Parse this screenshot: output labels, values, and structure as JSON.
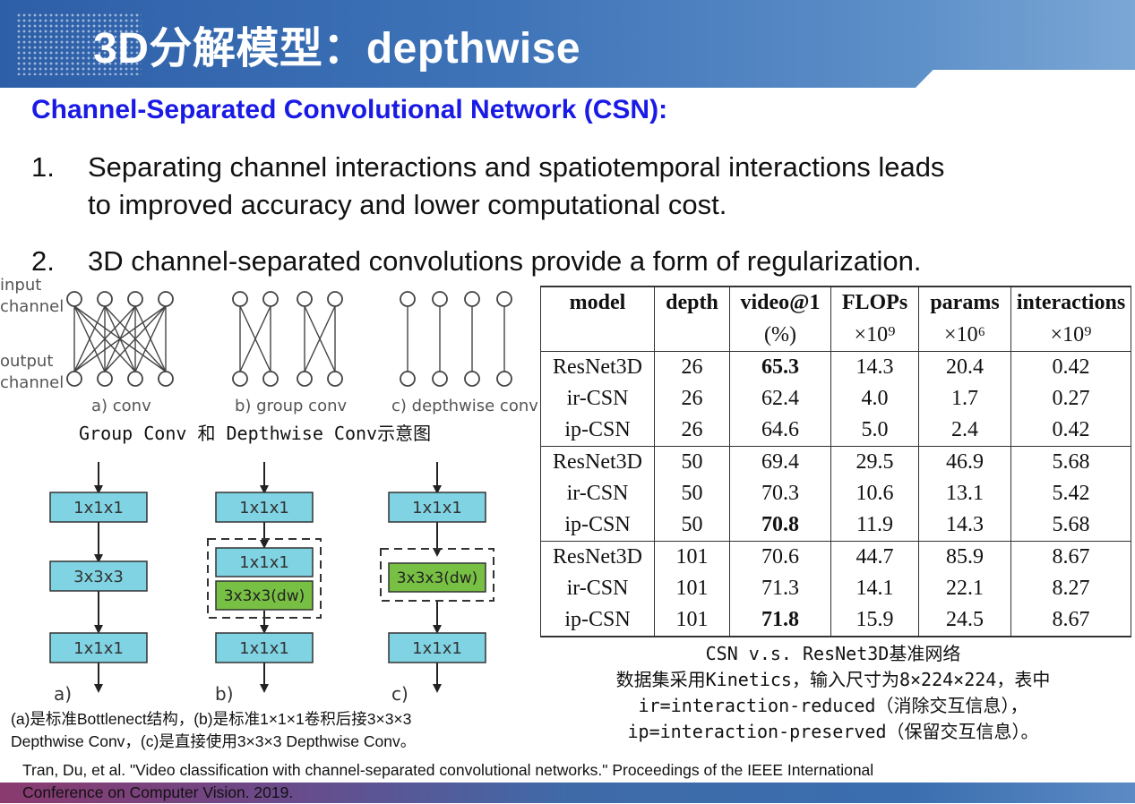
{
  "title": "3D分解模型：depthwise",
  "subtitle": "Channel-Separated Convolutional Network (CSN):",
  "points": [
    {
      "num": "1.",
      "line1": "Separating channel interactions and spatiotemporal interactions leads",
      "line2": "to improved accuracy and lower computational cost."
    },
    {
      "num": "2.",
      "line1": "3D channel-separated convolutions provide a form of regularization."
    }
  ],
  "conv_figure": {
    "input_label_1": "input",
    "input_label_2": "channel",
    "output_label_1": "output",
    "output_label_2": "channel",
    "conv_label": "a) conv",
    "group_label": "b) group conv",
    "depthwise_label": "c) depthwise conv",
    "caption": "Group Conv 和 Depthwise Conv示意图"
  },
  "block_figure": {
    "box_1x1x1": "1x1x1",
    "box_3x3x3": "3x3x3",
    "box_dw": "3x3x3(dw)",
    "label_a": "a)",
    "label_b": "b)",
    "label_c": "c)",
    "caption_line1": "(a)是标准Bottlenect结构，(b)是标准1×1×1卷积后接3×3×3",
    "caption_line2": "Depthwise Conv，(c)是直接使用3×3×3 Depthwise Conv。"
  },
  "table": {
    "headers": [
      "model",
      "depth",
      "video@1",
      "FLOPs",
      "params",
      "interactions"
    ],
    "units": [
      "",
      "",
      "(%)",
      "×10⁹",
      "×10⁶",
      "×10⁹"
    ],
    "groups": [
      [
        {
          "model": "ResNet3D",
          "depth": "26",
          "video": "65.3",
          "flops": "14.3",
          "params": "20.4",
          "inter": "0.42",
          "bold": true
        },
        {
          "model": "ir-CSN",
          "depth": "26",
          "video": "62.4",
          "flops": "4.0",
          "params": "1.7",
          "inter": "0.27",
          "bold": false
        },
        {
          "model": "ip-CSN",
          "depth": "26",
          "video": "64.6",
          "flops": "5.0",
          "params": "2.4",
          "inter": "0.42",
          "bold": false
        }
      ],
      [
        {
          "model": "ResNet3D",
          "depth": "50",
          "video": "69.4",
          "flops": "29.5",
          "params": "46.9",
          "inter": "5.68",
          "bold": false
        },
        {
          "model": "ir-CSN",
          "depth": "50",
          "video": "70.3",
          "flops": "10.6",
          "params": "13.1",
          "inter": "5.42",
          "bold": false
        },
        {
          "model": "ip-CSN",
          "depth": "50",
          "video": "70.8",
          "flops": "11.9",
          "params": "14.3",
          "inter": "5.68",
          "bold": true
        }
      ],
      [
        {
          "model": "ResNet3D",
          "depth": "101",
          "video": "70.6",
          "flops": "44.7",
          "params": "85.9",
          "inter": "8.67",
          "bold": false
        },
        {
          "model": "ir-CSN",
          "depth": "101",
          "video": "71.3",
          "flops": "14.1",
          "params": "22.1",
          "inter": "8.27",
          "bold": false
        },
        {
          "model": "ip-CSN",
          "depth": "101",
          "video": "71.8",
          "flops": "15.9",
          "params": "24.5",
          "inter": "8.67",
          "bold": true
        }
      ]
    ]
  },
  "table_caption": {
    "line1": "CSN v.s. ResNet3D基准网络",
    "line2": "数据集采用Kinetics，输入尺寸为8×224×224，表中",
    "line3": "ir=interaction-reduced（消除交互信息），",
    "line4": "ip=interaction-preserved（保留交互信息）。"
  },
  "reference": {
    "line1": "Tran, Du, et al. \"Video classification with channel-separated convolutional networks.\" Proceedings of the IEEE International",
    "line2": "Conference on Computer Vision. 2019."
  },
  "colors": {
    "header": "#3f74b8",
    "subtitle": "#1a1ae6",
    "box_blue": "#7fd3e3",
    "box_green": "#77c043"
  }
}
